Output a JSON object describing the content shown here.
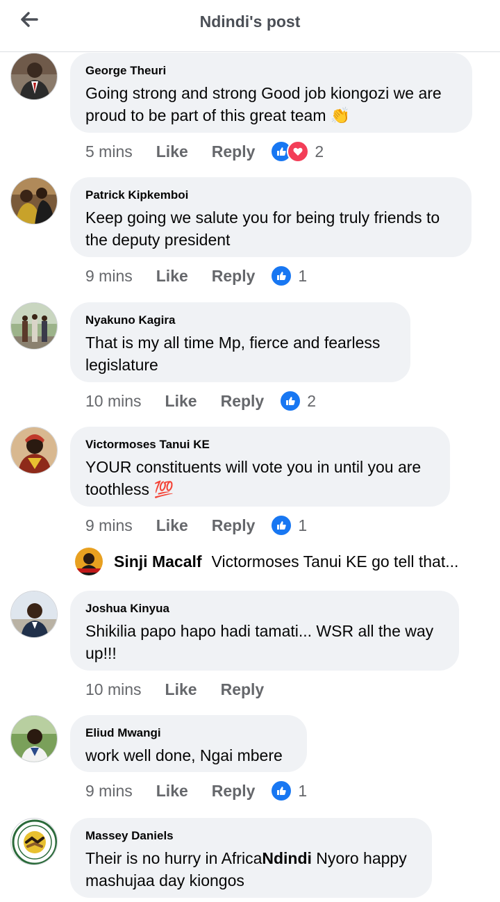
{
  "header": {
    "title": "Ndindi's post",
    "back_icon": "back-arrow-icon"
  },
  "colors": {
    "like_blue": "#1877f2",
    "love_red": "#f33e58",
    "bubble_bg": "#f0f2f5",
    "meta_gray": "#65676b"
  },
  "comments": [
    {
      "author": "George Theuri",
      "text": "Going strong and strong Good job kiongozi we are proud to be part of this great team",
      "emoji": "👏",
      "time": "5 mins",
      "like_label": "Like",
      "reply_label": "Reply",
      "reactions": [
        "like",
        "love"
      ],
      "reaction_count": "2"
    },
    {
      "author": "Patrick Kipkemboi",
      "text": "Keep going we salute you for being truly friends to the deputy president",
      "time": "9 mins",
      "like_label": "Like",
      "reply_label": "Reply",
      "reactions": [
        "like"
      ],
      "reaction_count": "1"
    },
    {
      "author": "Nyakuno Kagira",
      "text": "That is my all time Mp, fierce and fearless legislature",
      "time": "10 mins",
      "like_label": "Like",
      "reply_label": "Reply",
      "reactions": [
        "like"
      ],
      "reaction_count": "2"
    },
    {
      "author": "Victormoses Tanui KE",
      "text": "YOUR constituents will vote you in until you are toothless",
      "emoji": "💯",
      "time": "9 mins",
      "like_label": "Like",
      "reply_label": "Reply",
      "reactions": [
        "like"
      ],
      "reaction_count": "1",
      "reply_preview": {
        "author": "Sinji Macalf",
        "text": "Victormoses Tanui KE go tell that..."
      }
    },
    {
      "author": "Joshua Kinyua",
      "text": "Shikilia papo hapo hadi tamati... WSR all the way up!!!",
      "time": "10 mins",
      "like_label": "Like",
      "reply_label": "Reply"
    },
    {
      "author": "Eliud Mwangi",
      "text": "work well done, Ngai mbere",
      "time": "9 mins",
      "like_label": "Like",
      "reply_label": "Reply",
      "reactions": [
        "like"
      ],
      "reaction_count": "1"
    },
    {
      "author": "Massey Daniels",
      "text_before": "Their is no hurry in Africa",
      "text_bold": "Ndindi",
      "text_after": " Nyoro happy mashujaa day kiongos"
    }
  ]
}
